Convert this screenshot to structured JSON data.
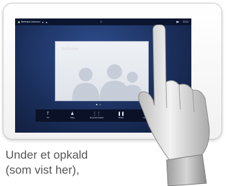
{
  "status_bar": {
    "user_name": "Bertrand Johnson",
    "home_icon": "home-icon",
    "clock": "13:11"
  },
  "screen": {
    "conference_label": "Konference",
    "tab_hint": "Tab ▸"
  },
  "call_controls": [
    {
      "name": "add-button",
      "icon": "add-participant-icon",
      "label": "Tilf"
    },
    {
      "name": "participants-button",
      "icon": "person-icon",
      "label": "Tilfæj"
    },
    {
      "name": "keypad-button",
      "icon": "keypad-icon",
      "label": "Numerisk tastatur"
    },
    {
      "name": "hold-button",
      "icon": "pause-icon",
      "label": "Parkér"
    },
    {
      "name": "share-button",
      "icon": "share-icon",
      "label": "Omstil"
    }
  ],
  "caption_lines": [
    "Under et opkald",
    "(som vist her),"
  ]
}
